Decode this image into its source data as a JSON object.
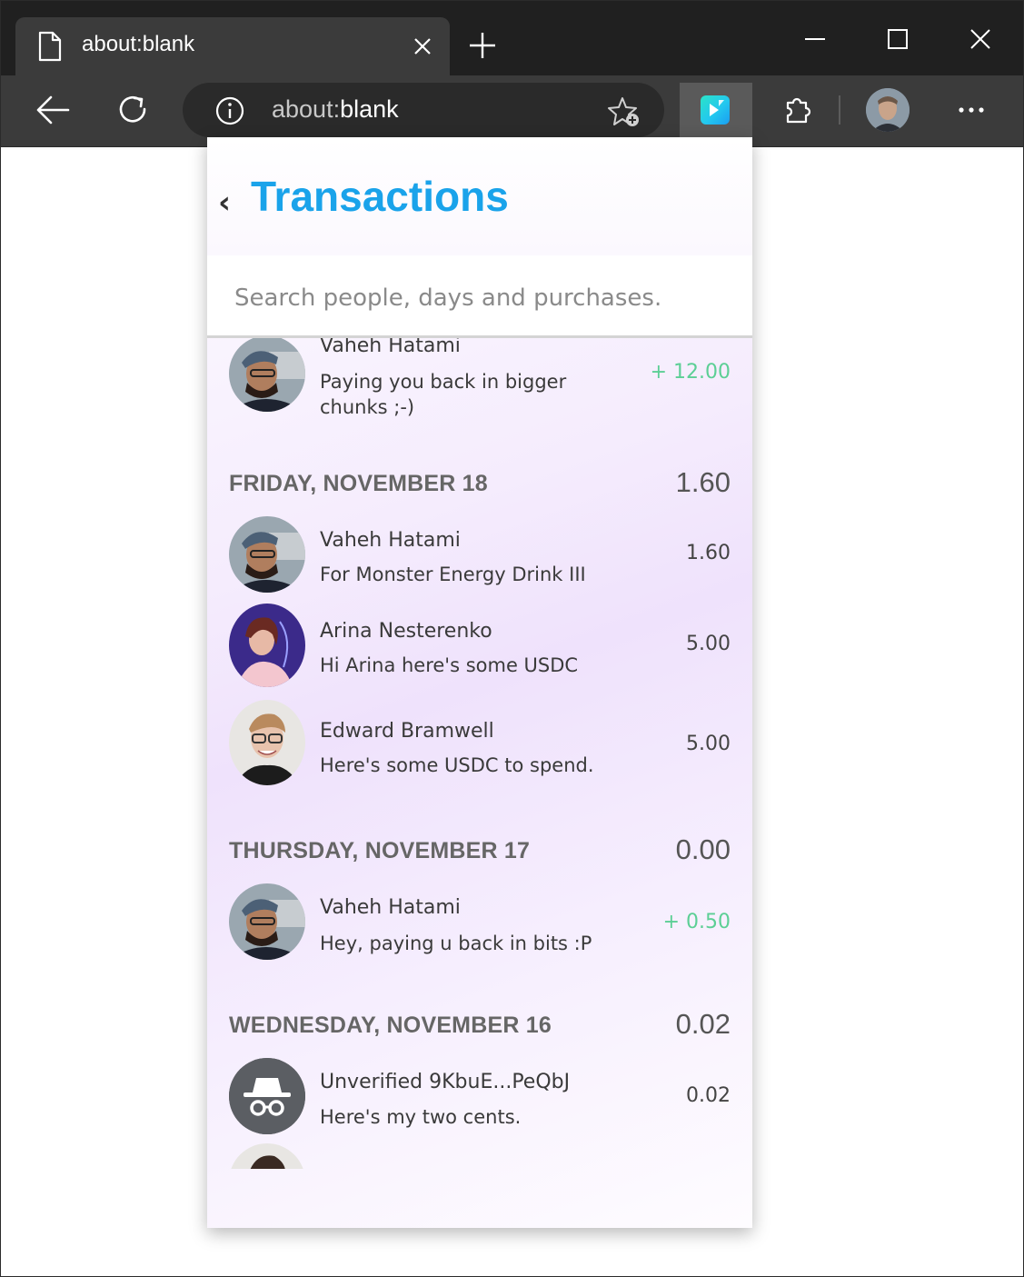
{
  "browser": {
    "tab_title": "about:blank",
    "url_scheme": "about:",
    "url_host": "blank"
  },
  "popup": {
    "title": "Transactions",
    "search_placeholder": "Search people, days and purchases."
  },
  "transactions": {
    "top_item": {
      "name": "Vaheh Hatami",
      "memo": "Paying you back in bigger chunks ;-)",
      "amount": "+ 12.00"
    },
    "days": [
      {
        "label": "FRIDAY, NOVEMBER 18",
        "total": "1.60",
        "items": [
          {
            "name": "Vaheh Hatami",
            "memo": "For Monster Energy Drink III",
            "amount": "1.60"
          },
          {
            "name": "Arina Nesterenko",
            "memo": "Hi Arina here's some USDC",
            "amount": "5.00"
          },
          {
            "name": "Edward Bramwell",
            "memo": "Here's some USDC to spend.",
            "amount": "5.00"
          }
        ]
      },
      {
        "label": "THURSDAY, NOVEMBER 17",
        "total": "0.00",
        "items": [
          {
            "name": "Vaheh Hatami",
            "memo": "Hey, paying u back in bits :P",
            "amount": "+ 0.50"
          }
        ]
      },
      {
        "label": "WEDNESDAY, NOVEMBER 16",
        "total": "0.02",
        "items": [
          {
            "name": "Unverified 9KbuE...PeQbJ",
            "memo": "Here's my two cents.",
            "amount": "0.02"
          }
        ]
      }
    ]
  },
  "colors": {
    "title_blue": "#1aa3ea",
    "positive_green": "#5ccf95",
    "browser_dark": "#202020",
    "browser_toolbar": "#3b3b3b"
  }
}
